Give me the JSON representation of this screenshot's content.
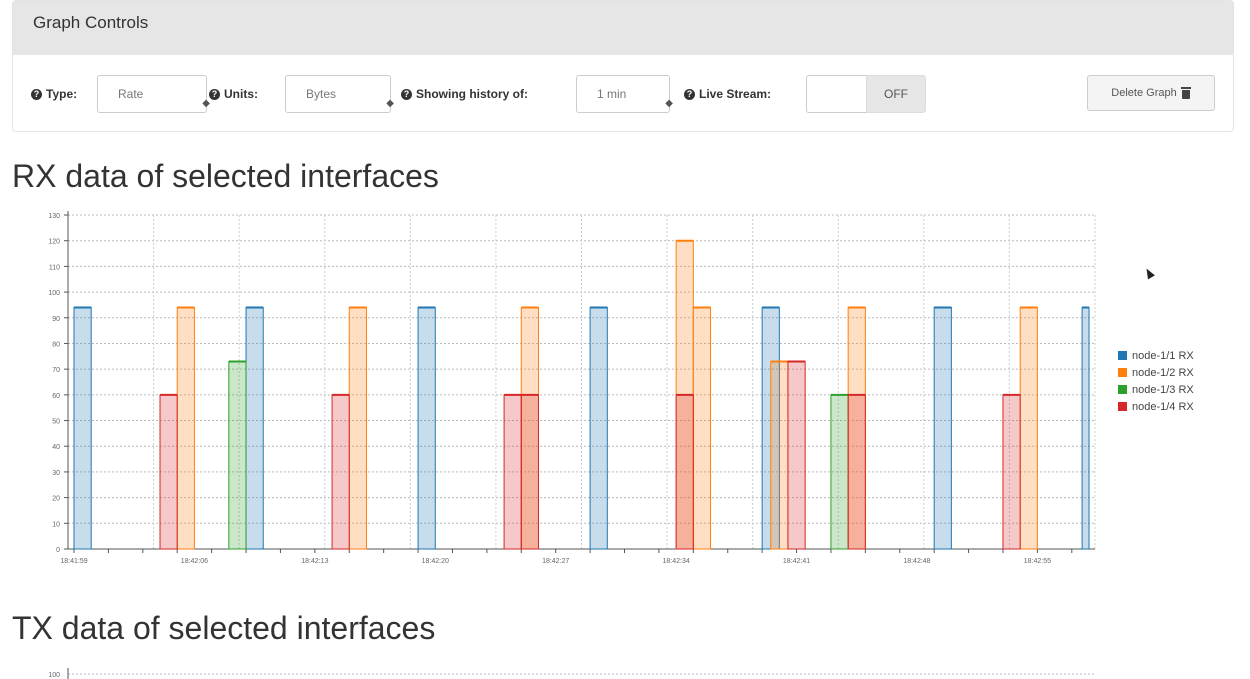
{
  "panel": {
    "title": "Graph Controls"
  },
  "controls": {
    "type_label": "Type:",
    "type_value": "Rate",
    "units_label": "Units:",
    "units_value": "Bytes",
    "history_label": "Showing history of:",
    "history_value": "1 min",
    "live_label": "Live Stream:",
    "live_toggle": "OFF",
    "delete_label": "Delete Graph"
  },
  "rx": {
    "title": "RX data of selected interfaces"
  },
  "tx": {
    "title": "TX data of selected interfaces",
    "first_tick": "100"
  },
  "legend": [
    {
      "label": "node-1/1 RX",
      "color": "#1f77b4"
    },
    {
      "label": "node-1/2 RX",
      "color": "#ff7f0e"
    },
    {
      "label": "node-1/3 RX",
      "color": "#2ca02c"
    },
    {
      "label": "node-1/4 RX",
      "color": "#d62728"
    }
  ],
  "chart_data": {
    "type": "bar",
    "title": "RX data of selected interfaces",
    "xlabel": "",
    "ylabel": "",
    "ylim": [
      0,
      130
    ],
    "yticks": [
      0,
      10,
      20,
      30,
      40,
      50,
      60,
      70,
      80,
      90,
      100,
      110,
      120,
      130
    ],
    "xticks": [
      "18:41:59",
      "18:42:06",
      "18:42:13",
      "18:42:20",
      "18:42:27",
      "18:42:34",
      "18:42:41",
      "18:42:48",
      "18:42:55"
    ],
    "xrange": [
      0,
      59
    ],
    "series": [
      {
        "name": "node-1/1 RX",
        "color": "#1f77b4",
        "bars": [
          {
            "x": 0,
            "w": 1,
            "v": 94
          },
          {
            "x": 10,
            "w": 1,
            "v": 94
          },
          {
            "x": 20,
            "w": 1,
            "v": 94
          },
          {
            "x": 30,
            "w": 1,
            "v": 94
          },
          {
            "x": 40,
            "w": 1,
            "v": 94
          },
          {
            "x": 50,
            "w": 1,
            "v": 94
          },
          {
            "x": 58.6,
            "w": 0.4,
            "v": 94
          }
        ]
      },
      {
        "name": "node-1/2 RX",
        "color": "#ff7f0e",
        "bars": [
          {
            "x": 6,
            "w": 1,
            "v": 94
          },
          {
            "x": 16,
            "w": 1,
            "v": 94
          },
          {
            "x": 26,
            "w": 1,
            "v": 94
          },
          {
            "x": 35,
            "w": 1,
            "v": 120
          },
          {
            "x": 36,
            "w": 1,
            "v": 94
          },
          {
            "x": 40.5,
            "w": 1,
            "v": 73
          },
          {
            "x": 45,
            "w": 1,
            "v": 94
          },
          {
            "x": 55,
            "w": 1,
            "v": 94
          }
        ]
      },
      {
        "name": "node-1/3 RX",
        "color": "#2ca02c",
        "bars": [
          {
            "x": 9,
            "w": 1,
            "v": 73
          },
          {
            "x": 44,
            "w": 1,
            "v": 60
          }
        ]
      },
      {
        "name": "node-1/4 RX",
        "color": "#d62728",
        "bars": [
          {
            "x": 5,
            "w": 1,
            "v": 60
          },
          {
            "x": 15,
            "w": 1,
            "v": 60
          },
          {
            "x": 25,
            "w": 1,
            "v": 60
          },
          {
            "x": 26,
            "w": 1,
            "v": 60
          },
          {
            "x": 35,
            "w": 1,
            "v": 60
          },
          {
            "x": 41.5,
            "w": 1,
            "v": 73
          },
          {
            "x": 45,
            "w": 1,
            "v": 60
          },
          {
            "x": 54,
            "w": 1,
            "v": 60
          }
        ]
      }
    ]
  }
}
